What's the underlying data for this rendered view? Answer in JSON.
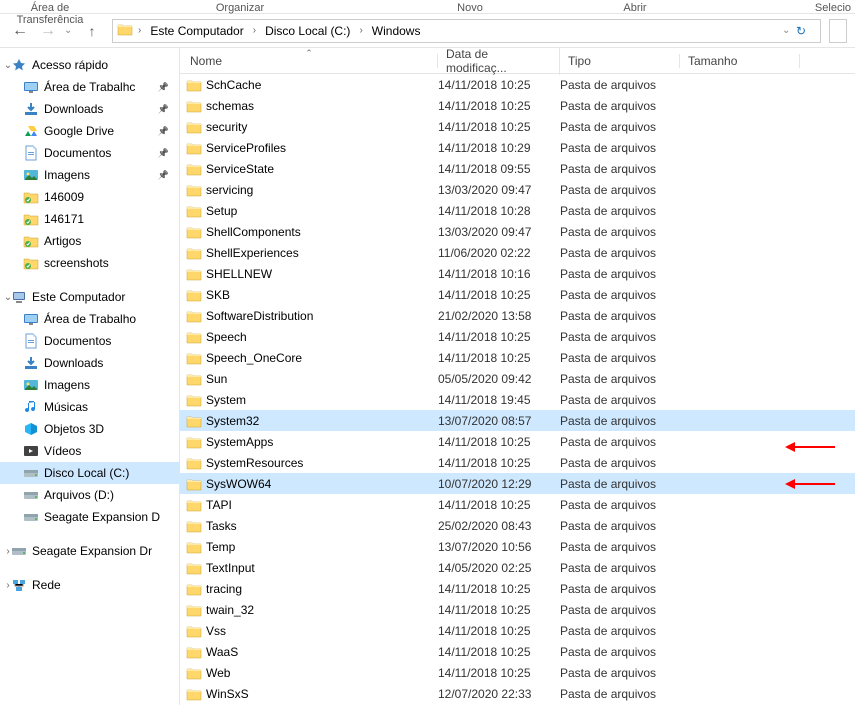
{
  "toolbar_hints": {
    "a": "Área de Transferência",
    "b": "Organizar",
    "c": "Novo",
    "d": "Abrir",
    "e": "Selecio"
  },
  "path": {
    "segments": [
      "Este Computador",
      "Disco Local (C:)",
      "Windows"
    ]
  },
  "columns": {
    "name": "Nome",
    "date": "Data de modificaç...",
    "type": "Tipo",
    "size": "Tamanho"
  },
  "sidebar": {
    "quick": {
      "label": "Acesso rápido",
      "items": [
        {
          "label": "Área de Trabalho",
          "pinned": true,
          "truncated": "Área de Trabalhc",
          "icon": "desktop"
        },
        {
          "label": "Downloads",
          "pinned": true,
          "icon": "downloads"
        },
        {
          "label": "Google Drive",
          "pinned": true,
          "icon": "gdrive"
        },
        {
          "label": "Documentos",
          "pinned": true,
          "icon": "documents"
        },
        {
          "label": "Imagens",
          "pinned": true,
          "icon": "pictures"
        },
        {
          "label": "146009",
          "pinned": false,
          "icon": "folder-green"
        },
        {
          "label": "146171",
          "pinned": false,
          "icon": "folder-green"
        },
        {
          "label": "Artigos",
          "pinned": false,
          "icon": "folder-green"
        },
        {
          "label": "screenshots",
          "pinned": false,
          "icon": "folder-green"
        }
      ]
    },
    "computer": {
      "label": "Este Computador",
      "items": [
        {
          "label": "Área de Trabalho",
          "icon": "desktop"
        },
        {
          "label": "Documentos",
          "icon": "documents"
        },
        {
          "label": "Downloads",
          "icon": "downloads"
        },
        {
          "label": "Imagens",
          "icon": "pictures"
        },
        {
          "label": "Músicas",
          "icon": "music"
        },
        {
          "label": "Objetos 3D",
          "icon": "objects3d"
        },
        {
          "label": "Vídeos",
          "icon": "videos"
        },
        {
          "label": "Disco Local (C:)",
          "icon": "drive",
          "selected": true
        },
        {
          "label": "Arquivos (D:)",
          "icon": "drive"
        },
        {
          "label": "Seagate Expansion D",
          "icon": "drive",
          "truncated": "Seagate Expansion D"
        }
      ]
    },
    "extra": [
      {
        "label": "Seagate Expansion Dr",
        "icon": "drive"
      }
    ],
    "network": {
      "label": "Rede",
      "icon": "network"
    }
  },
  "type_label": "Pasta de arquivos",
  "files": [
    {
      "name": "SchCache",
      "date": "14/11/2018 10:25"
    },
    {
      "name": "schemas",
      "date": "14/11/2018 10:25"
    },
    {
      "name": "security",
      "date": "14/11/2018 10:25"
    },
    {
      "name": "ServiceProfiles",
      "date": "14/11/2018 10:29"
    },
    {
      "name": "ServiceState",
      "date": "14/11/2018 09:55"
    },
    {
      "name": "servicing",
      "date": "13/03/2020 09:47"
    },
    {
      "name": "Setup",
      "date": "14/11/2018 10:28"
    },
    {
      "name": "ShellComponents",
      "date": "13/03/2020 09:47"
    },
    {
      "name": "ShellExperiences",
      "date": "11/06/2020 02:22"
    },
    {
      "name": "SHELLNEW",
      "date": "14/11/2018 10:16"
    },
    {
      "name": "SKB",
      "date": "14/11/2018 10:25"
    },
    {
      "name": "SoftwareDistribution",
      "date": "21/02/2020 13:58"
    },
    {
      "name": "Speech",
      "date": "14/11/2018 10:25"
    },
    {
      "name": "Speech_OneCore",
      "date": "14/11/2018 10:25"
    },
    {
      "name": "Sun",
      "date": "05/05/2020 09:42"
    },
    {
      "name": "System",
      "date": "14/11/2018 19:45"
    },
    {
      "name": "System32",
      "date": "13/07/2020 08:57",
      "highlight": true,
      "arrow": true
    },
    {
      "name": "SystemApps",
      "date": "14/11/2018 10:25"
    },
    {
      "name": "SystemResources",
      "date": "14/11/2018 10:25"
    },
    {
      "name": "SysWOW64",
      "date": "10/07/2020 12:29",
      "highlight": true,
      "arrow": true
    },
    {
      "name": "TAPI",
      "date": "14/11/2018 10:25"
    },
    {
      "name": "Tasks",
      "date": "25/02/2020 08:43"
    },
    {
      "name": "Temp",
      "date": "13/07/2020 10:56"
    },
    {
      "name": "TextInput",
      "date": "14/05/2020 02:25"
    },
    {
      "name": "tracing",
      "date": "14/11/2018 10:25"
    },
    {
      "name": "twain_32",
      "date": "14/11/2018 10:25"
    },
    {
      "name": "Vss",
      "date": "14/11/2018 10:25"
    },
    {
      "name": "WaaS",
      "date": "14/11/2018 10:25"
    },
    {
      "name": "Web",
      "date": "14/11/2018 10:25"
    },
    {
      "name": "WinSxS",
      "date": "12/07/2020 22:33"
    }
  ]
}
